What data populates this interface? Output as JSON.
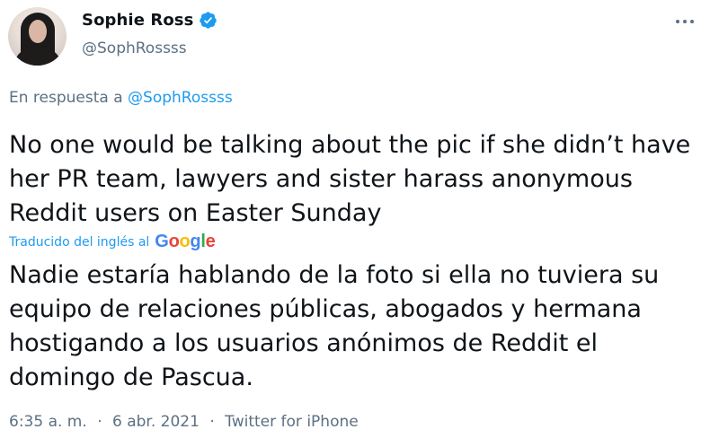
{
  "author": {
    "display_name": "Sophie Ross",
    "handle": "@SophRossss",
    "verified_color": "#1d9bf0"
  },
  "reply": {
    "prefix": "En respuesta a",
    "mention": "@SophRossss"
  },
  "tweet": {
    "text_en": "No one would be talking about the pic if she didn’t have her PR team, lawyers and sister harass anonymous Reddit users on Easter Sunday",
    "translated_label": "Traducido del inglés al",
    "translator": "Google",
    "text_es": "Nadie estaría hablando de la foto si ella no tuviera su equipo de relaciones públicas, abogados y hermana hostigando a los usuarios anónimos de Reddit el domingo de Pascua."
  },
  "meta": {
    "time": "6:35 a. m.",
    "separator": "·",
    "date": "6 abr. 2021",
    "source": "Twitter for iPhone"
  },
  "colors": {
    "link": "#1d9bf0",
    "secondary_text": "#5b7083",
    "google_blue": "#4285F4",
    "google_red": "#EA4335",
    "google_yellow": "#FBBC05",
    "google_green": "#34A853"
  }
}
